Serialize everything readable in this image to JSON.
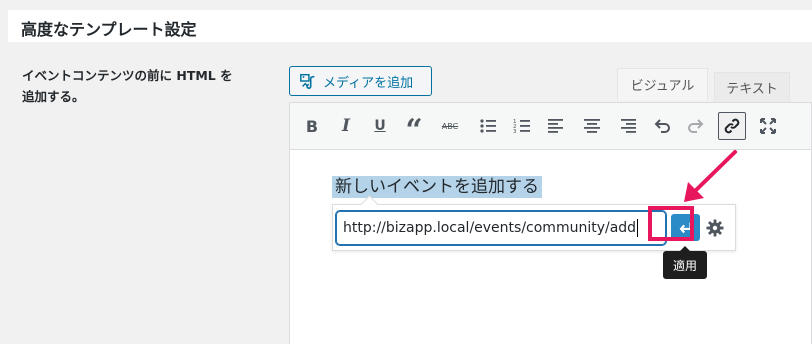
{
  "section": {
    "title": "高度なテンプレート設定"
  },
  "field": {
    "label_line1": "イベントコンテンツの前に HTML を",
    "label_line2": "追加する。"
  },
  "media_button": {
    "label": "メディアを追加",
    "icon": "media-add-icon"
  },
  "tabs": [
    {
      "label": "ビジュアル",
      "active": true
    },
    {
      "label": "テキスト",
      "active": false
    }
  ],
  "toolbar": [
    {
      "name": "bold",
      "glyph": "B"
    },
    {
      "name": "italic",
      "glyph": "I"
    },
    {
      "name": "underline",
      "glyph": "U"
    },
    {
      "name": "blockquote",
      "glyph": "“"
    },
    {
      "name": "strikethrough",
      "glyph": "ABC"
    },
    {
      "name": "bullet-list",
      "glyph": ""
    },
    {
      "name": "numbered-list",
      "glyph": ""
    },
    {
      "name": "align-left",
      "glyph": ""
    },
    {
      "name": "align-center",
      "glyph": ""
    },
    {
      "name": "align-right",
      "glyph": ""
    },
    {
      "name": "undo",
      "glyph": ""
    },
    {
      "name": "redo",
      "glyph": ""
    },
    {
      "name": "link",
      "glyph": ""
    },
    {
      "name": "fullscreen",
      "glyph": ""
    }
  ],
  "editor": {
    "selected_text": "新しいイベントを追加する"
  },
  "link_popup": {
    "url": "http://bizapp.local/events/community/add",
    "apply_tooltip": "適用"
  },
  "colors": {
    "accent": "#2b8bc7",
    "highlight": "#e8175d",
    "selection": "#b4d3e9"
  }
}
